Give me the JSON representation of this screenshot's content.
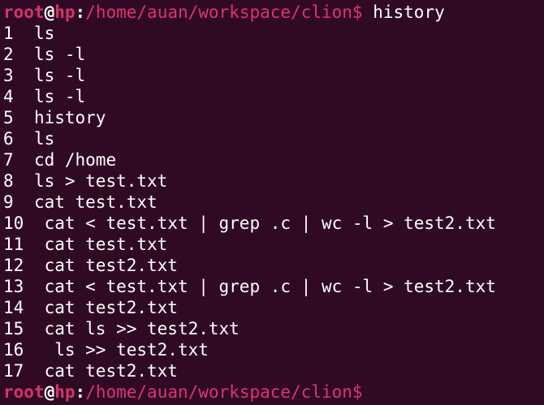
{
  "prompt": {
    "user": "root",
    "at": "@",
    "host": "hp",
    "colon": ":",
    "path": "/home/auan/workspace/clion",
    "symbol": "$"
  },
  "first_command": "history",
  "history": [
    {
      "num": "1",
      "sep": "  ",
      "cmd": "ls"
    },
    {
      "num": "2",
      "sep": "  ",
      "cmd": "ls -l"
    },
    {
      "num": "3",
      "sep": "  ",
      "cmd": "ls -l"
    },
    {
      "num": "4",
      "sep": "  ",
      "cmd": "ls -l"
    },
    {
      "num": "5",
      "sep": "  ",
      "cmd": "history"
    },
    {
      "num": "6",
      "sep": "  ",
      "cmd": "ls"
    },
    {
      "num": "7",
      "sep": "  ",
      "cmd": "cd /home"
    },
    {
      "num": "8",
      "sep": "  ",
      "cmd": "ls > test.txt"
    },
    {
      "num": "9",
      "sep": "  ",
      "cmd": "cat test.txt"
    },
    {
      "num": "10",
      "sep": "  ",
      "cmd": "cat < test.txt | grep .c | wc -l > test2.txt"
    },
    {
      "num": "11",
      "sep": "  ",
      "cmd": "cat test.txt"
    },
    {
      "num": "12",
      "sep": "  ",
      "cmd": "cat test2.txt"
    },
    {
      "num": "13",
      "sep": "  ",
      "cmd": "cat < test.txt | grep .c | wc -l > test2.txt"
    },
    {
      "num": "14",
      "sep": "  ",
      "cmd": "cat test2.txt"
    },
    {
      "num": "15",
      "sep": "  ",
      "cmd": "cat ls >> test2.txt"
    },
    {
      "num": "16",
      "sep": "   ",
      "cmd": "ls >> test2.txt"
    },
    {
      "num": "17",
      "sep": "  ",
      "cmd": "cat test2.txt"
    }
  ],
  "colors": {
    "background": "#300a24",
    "prompt_user_host": "#d6336c",
    "prompt_path": "#e0336f",
    "text": "#ffffff"
  }
}
